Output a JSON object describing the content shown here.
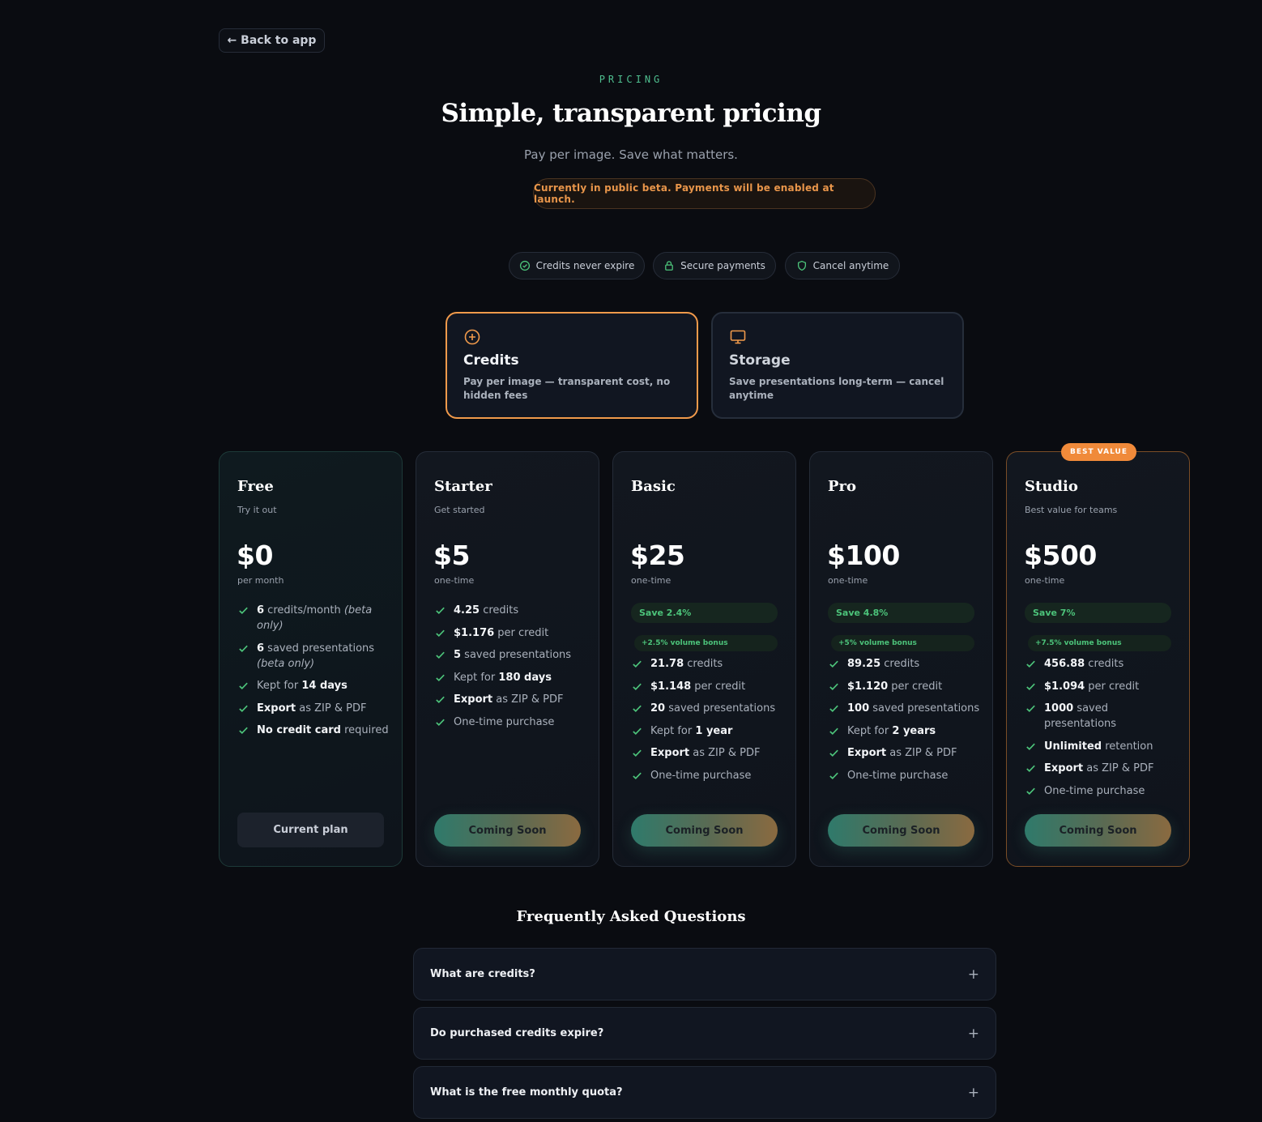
{
  "nav": {
    "back_label": "← Back to app"
  },
  "hero": {
    "eyebrow": "PRICING",
    "title": "Simple, transparent pricing",
    "subtitle": "Pay per image. Save what matters.",
    "beta_notice": "Currently in public beta. Payments will be enabled at launch."
  },
  "trust": [
    {
      "label": "Credits never expire",
      "icon": "check-circle-icon"
    },
    {
      "label": "Secure payments",
      "icon": "lock-icon"
    },
    {
      "label": "Cancel anytime",
      "icon": "shield-icon"
    }
  ],
  "modes": [
    {
      "title": "Credits",
      "desc": "Pay per image — transparent cost, no hidden fees",
      "icon": "plus-circle-icon",
      "active": true
    },
    {
      "title": "Storage",
      "desc": "Save presentations long-term — cancel anytime",
      "icon": "monitor-icon",
      "active": false
    }
  ],
  "plans": [
    {
      "name": "Free",
      "tagline": "Try it out",
      "price": "$0",
      "period": "per month",
      "button": "Current plan"
    },
    {
      "name": "Starter",
      "tagline": "Get started",
      "price": "$5",
      "period": "one-time",
      "button": "Coming Soon"
    },
    {
      "name": "Basic",
      "tagline": "",
      "price": "$25",
      "period": "one-time",
      "save": "Save 2.4%",
      "bonus": "+2.5% volume bonus",
      "button": "Coming Soon"
    },
    {
      "name": "Pro",
      "tagline": "",
      "price": "$100",
      "period": "one-time",
      "save": "Save 4.8%",
      "bonus": "+5% volume bonus",
      "button": "Coming Soon"
    },
    {
      "name": "Studio",
      "tagline": "Best value for teams",
      "price": "$500",
      "period": "one-time",
      "save": "Save 7%",
      "bonus": "+7.5% volume bonus",
      "button": "Coming Soon",
      "badge": "BEST VALUE"
    }
  ],
  "features": {
    "free": [
      {
        "b": "6",
        "t": " credits/month ",
        "i": "(beta only)"
      },
      {
        "b": "6",
        "t": " saved presentations ",
        "i": "(beta only)"
      },
      {
        "t": "Kept for ",
        "b2": "14 days"
      },
      {
        "b": "Export",
        "t": " as ZIP & PDF"
      },
      {
        "b": "No credit card",
        "t": " required"
      }
    ],
    "starter": [
      {
        "b": "4.25",
        "t": " credits"
      },
      {
        "b": "$1.176",
        "t": " per credit"
      },
      {
        "b": "5",
        "t": " saved presentations"
      },
      {
        "t": "Kept for ",
        "b2": "180 days"
      },
      {
        "b": "Export",
        "t": " as ZIP & PDF"
      },
      {
        "t": "One-time purchase"
      }
    ],
    "basic": [
      {
        "b": "21.78",
        "t": " credits"
      },
      {
        "b": "$1.148",
        "t": " per credit"
      },
      {
        "b": "20",
        "t": " saved presentations"
      },
      {
        "t": "Kept for ",
        "b2": "1 year"
      },
      {
        "b": "Export",
        "t": " as ZIP & PDF"
      },
      {
        "t": "One-time purchase"
      }
    ],
    "pro": [
      {
        "b": "89.25",
        "t": " credits"
      },
      {
        "b": "$1.120",
        "t": " per credit"
      },
      {
        "b": "100",
        "t": " saved presentations"
      },
      {
        "t": "Kept for ",
        "b2": "2 years"
      },
      {
        "b": "Export",
        "t": " as ZIP & PDF"
      },
      {
        "t": "One-time purchase"
      }
    ],
    "studio": [
      {
        "b": "456.88",
        "t": " credits"
      },
      {
        "b": "$1.094",
        "t": " per credit"
      },
      {
        "b": "1000",
        "t": " saved presentations"
      },
      {
        "b": "Unlimited",
        "t": " retention"
      },
      {
        "b": "Export",
        "t": " as ZIP & PDF"
      },
      {
        "t": "One-time purchase"
      }
    ]
  },
  "faq": {
    "title": "Frequently Asked Questions",
    "items": [
      {
        "q": "What are credits?",
        "icon": "plus-icon"
      },
      {
        "q": "Do purchased credits expire?",
        "icon": "plus-icon"
      },
      {
        "q": "What is the free monthly quota?",
        "icon": "plus-icon"
      }
    ]
  },
  "colors": {
    "accent": "#f19a4b",
    "success": "#4cc37a",
    "teal": "#4fbf8f",
    "bg": "#0a0c11"
  }
}
